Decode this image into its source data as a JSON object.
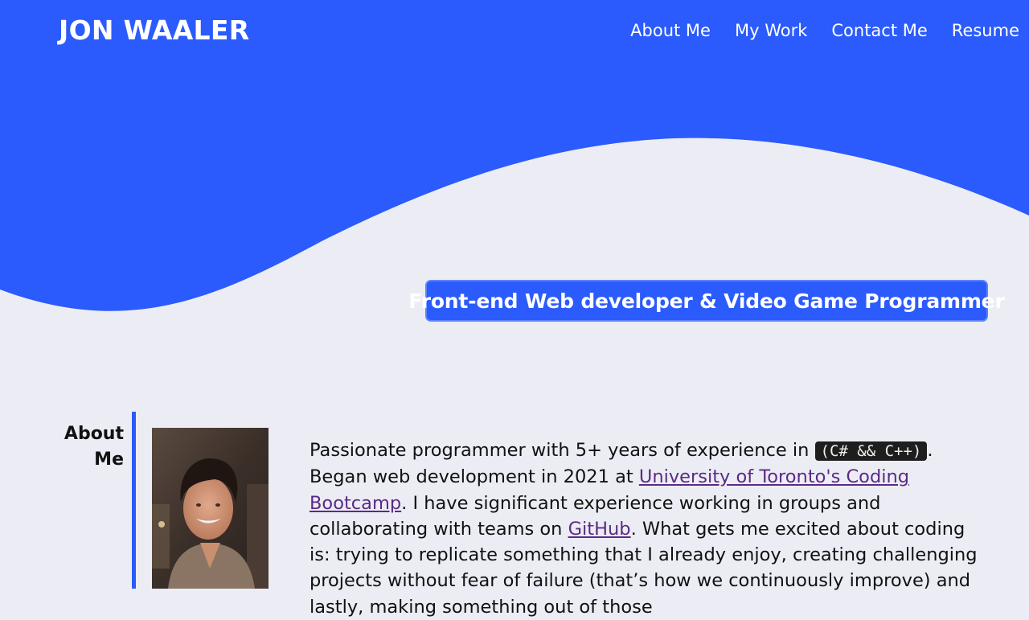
{
  "header": {
    "title": "JON WAALER",
    "nav": [
      "About Me",
      "My Work",
      "Contact Me",
      "Resume"
    ]
  },
  "hero": {
    "tagline": "Front-end Web developer & Video Game Programmer"
  },
  "about": {
    "heading": "About Me",
    "photo_icon": "profile-photo",
    "text_before_code": "Passionate programmer with 5+ years of experience in ",
    "code": "(C# && C++)",
    "text_after_code": ". Began web development in 2021 at ",
    "bootcamp_link": "University of Toronto's Coding Bootcamp",
    "text_after_bootcamp": ". I have significant experience working in groups and collaborating with teams on ",
    "github_link": "GitHub",
    "text_after_github": ". What gets me excited about coding is: trying to replicate something that I already enjoy, creating challenging projects without fear of failure (that’s how we continuously improve) and lastly, making something out of those"
  },
  "colors": {
    "accent": "#2b5bfc",
    "background": "#ecedf4",
    "link_visited": "#5b2a86",
    "code_bg": "#1e1e1e"
  }
}
